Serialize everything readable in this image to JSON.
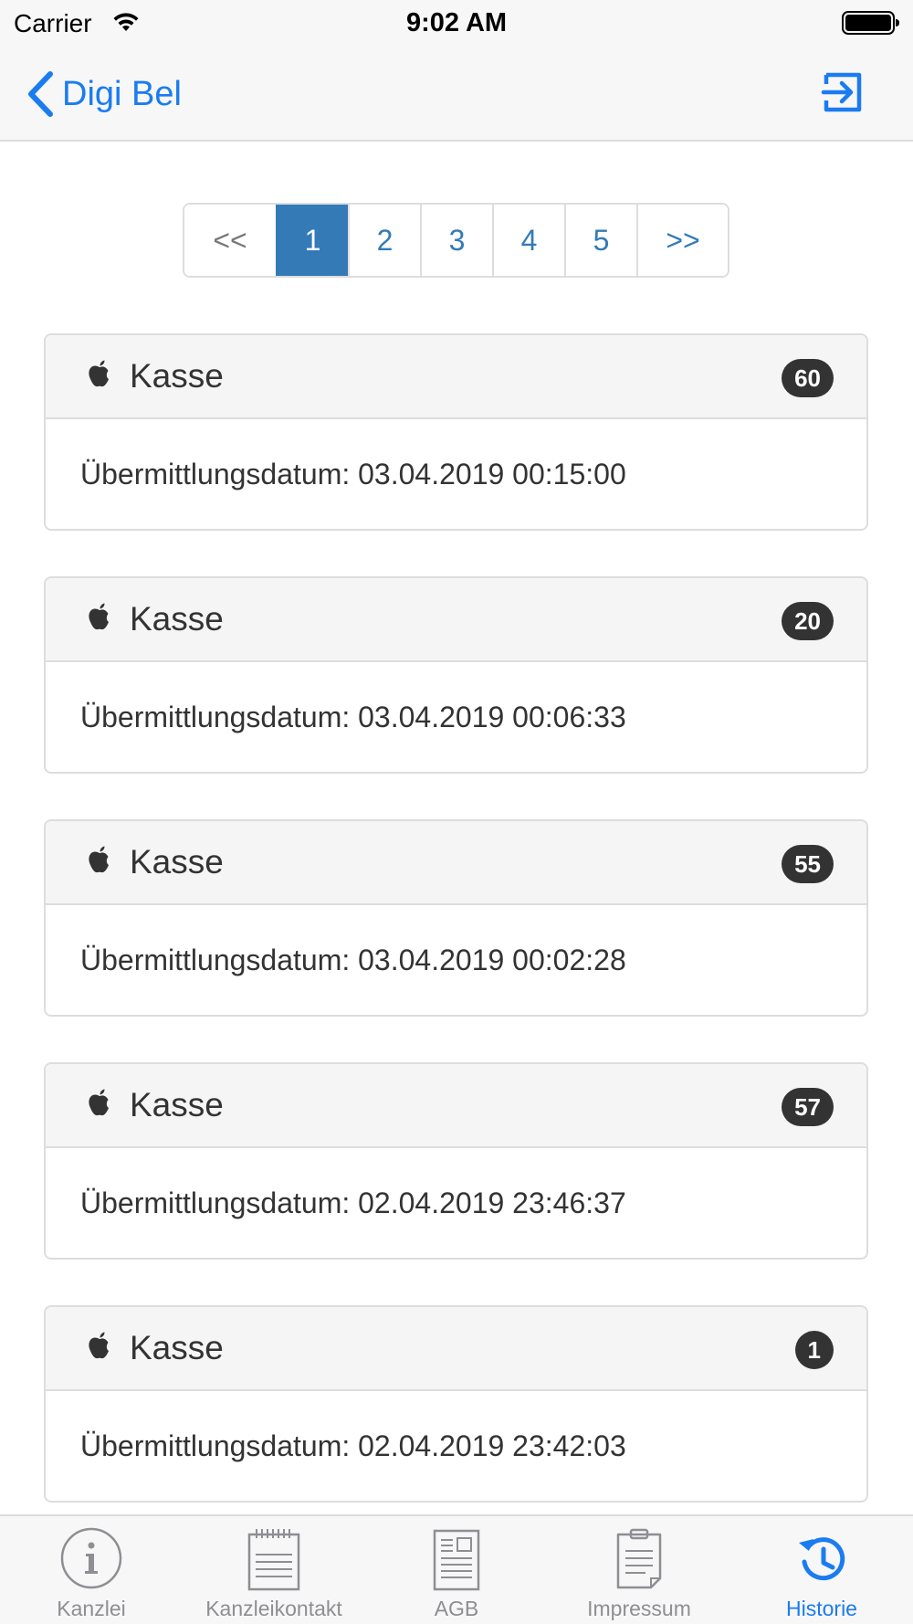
{
  "status_bar": {
    "carrier": "Carrier",
    "time": "9:02 AM"
  },
  "nav": {
    "back_label": "Digi Bel",
    "logout_icon": "logout-icon"
  },
  "pagination": {
    "prev": "<<",
    "next": ">>",
    "pages": [
      "1",
      "2",
      "3",
      "4",
      "5"
    ],
    "active": "1"
  },
  "cards": [
    {
      "icon": "apple-icon",
      "title": "Kasse",
      "badge": "60",
      "date": "Übermittlungsdatum: 03.04.2019 00:15:00"
    },
    {
      "icon": "apple-icon",
      "title": "Kasse",
      "badge": "20",
      "date": "Übermittlungsdatum: 03.04.2019 00:06:33"
    },
    {
      "icon": "apple-icon",
      "title": "Kasse",
      "badge": "55",
      "date": "Übermittlungsdatum: 03.04.2019 00:02:28"
    },
    {
      "icon": "apple-icon",
      "title": "Kasse",
      "badge": "57",
      "date": "Übermittlungsdatum: 02.04.2019 23:46:37"
    },
    {
      "icon": "apple-icon",
      "title": "Kasse",
      "badge": "1",
      "date": "Übermittlungsdatum: 02.04.2019 23:42:03"
    }
  ],
  "tab_bar": {
    "tabs": [
      {
        "label": "Kanzlei",
        "icon": "info-icon"
      },
      {
        "label": "Kanzleikontakt",
        "icon": "notepad-icon"
      },
      {
        "label": "AGB",
        "icon": "document-icon"
      },
      {
        "label": "Impressum",
        "icon": "clipboard-icon"
      },
      {
        "label": "Historie",
        "icon": "history-icon"
      }
    ],
    "active": "Historie"
  },
  "colors": {
    "accent": "#1a7cf0",
    "pagination_active": "#337ab7",
    "badge": "#333333",
    "card_header": "#f5f5f5",
    "tab_inactive": "#8e8e93"
  }
}
